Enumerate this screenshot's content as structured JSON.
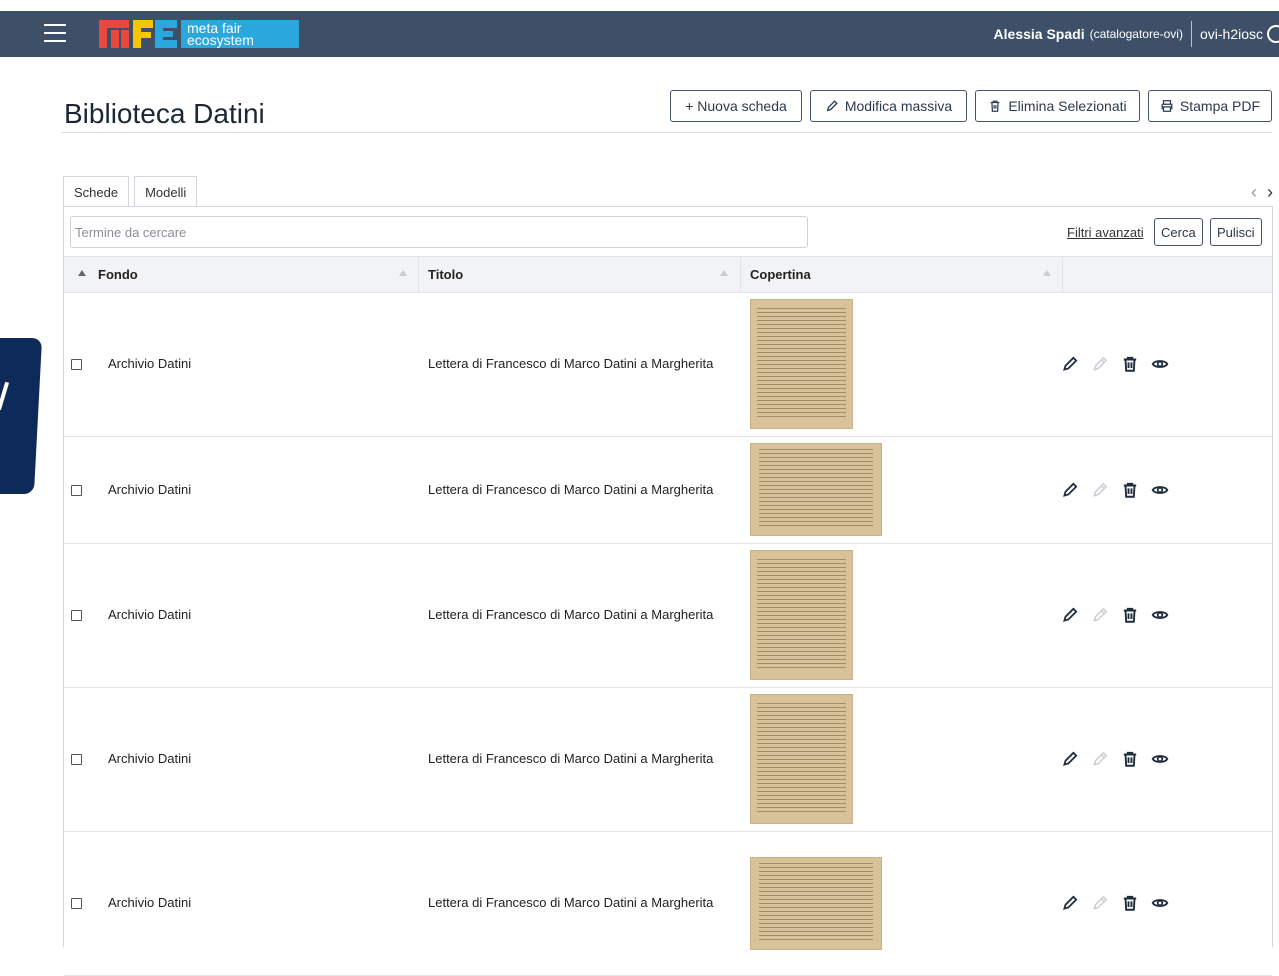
{
  "header": {
    "logo_text": "meta fair\necosystem",
    "user_name": "Alessia Spadi",
    "user_role": "(catalogatore-ovi)",
    "org": "ovi-h2iosc"
  },
  "page": {
    "title": "Biblioteca Datini",
    "actions": {
      "new": "+ Nuova scheda",
      "bulk_edit": "Modifica massiva",
      "delete_selected": "Elimina Selezionati",
      "print_pdf": "Stampa PDF"
    }
  },
  "tabs": [
    "Schede",
    "Modelli"
  ],
  "search": {
    "placeholder": "Termine da cercare",
    "advanced_filters": "Filtri avanzati",
    "search_btn": "Cerca",
    "clear_btn": "Pulisci"
  },
  "table": {
    "columns": [
      "Fondo",
      "Titolo",
      "Copertina"
    ],
    "rows": [
      {
        "fondo": "Archivio Datini",
        "titolo": "Lettera di Francesco di Marco Datini a Margherita",
        "cover": "portrait"
      },
      {
        "fondo": "Archivio Datini",
        "titolo": "Lettera di Francesco di Marco Datini a Margherita",
        "cover": "landscape"
      },
      {
        "fondo": "Archivio Datini",
        "titolo": "Lettera di Francesco di Marco Datini a Margherita",
        "cover": "portrait"
      },
      {
        "fondo": "Archivio Datini",
        "titolo": "Lettera di Francesco di Marco Datini a Margherita",
        "cover": "portrait"
      },
      {
        "fondo": "Archivio Datini",
        "titolo": "Lettera di Francesco di Marco Datini a Margherita",
        "cover": "landscape"
      }
    ],
    "row_icons": [
      "pencil-icon",
      "edit-disabled-icon",
      "trash-icon",
      "eye-icon"
    ]
  },
  "colors": {
    "topbar": "#3d5068",
    "logo_blue": "#2aa7dc",
    "logo_red": "#e8483f",
    "logo_yellow": "#f5c500"
  }
}
